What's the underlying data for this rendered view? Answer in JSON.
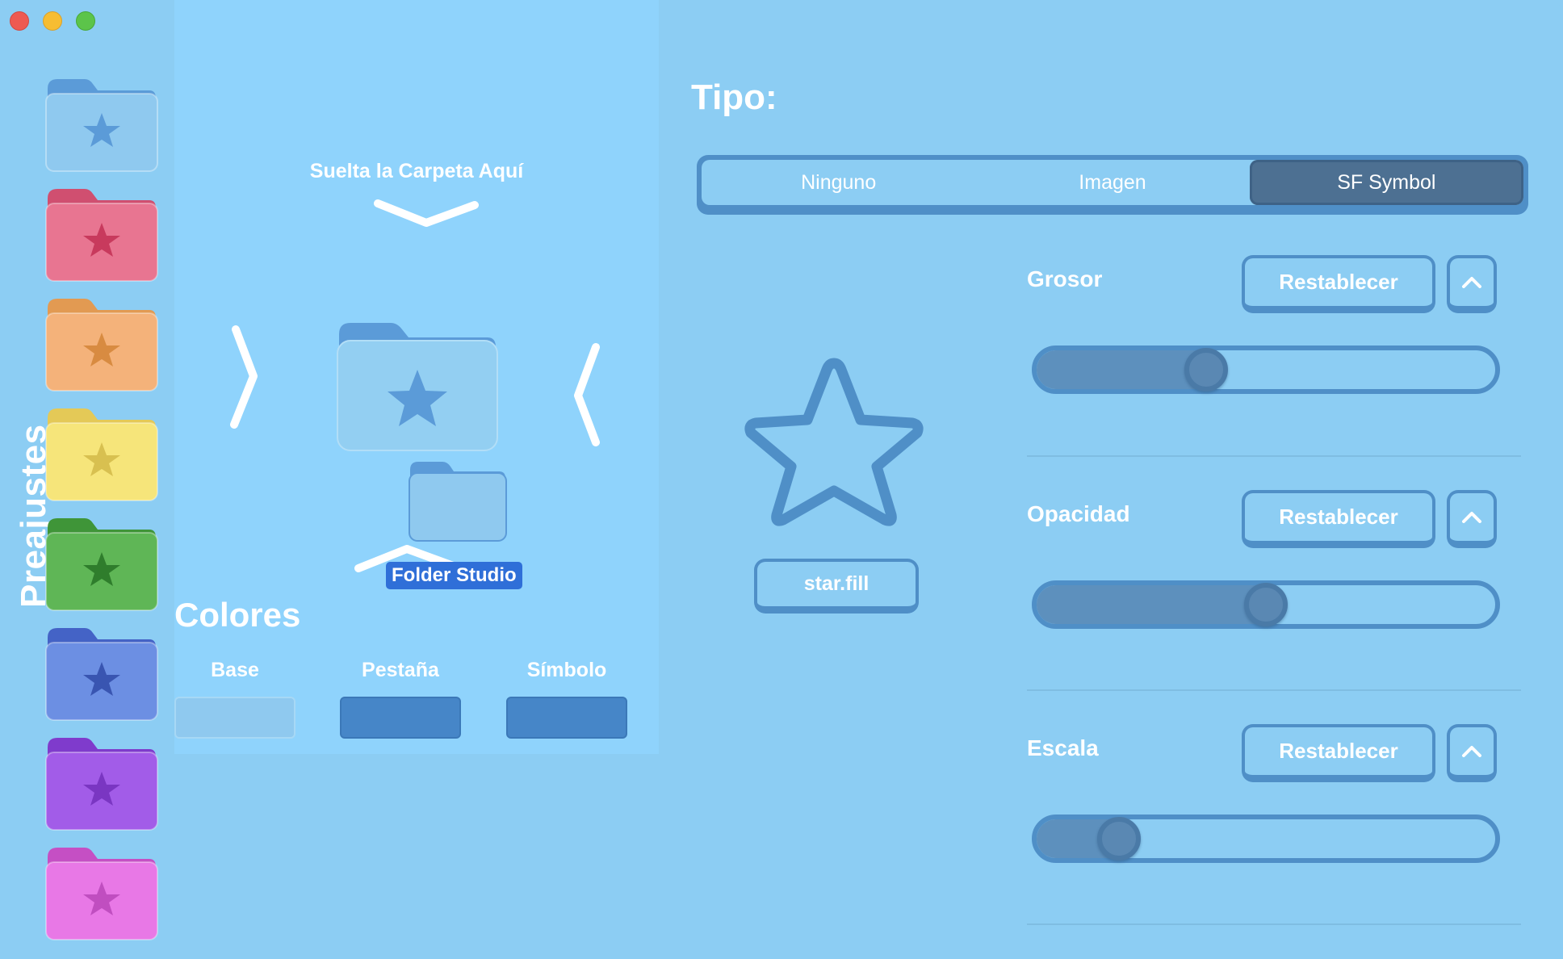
{
  "window": {
    "traffic_lights": [
      "close",
      "minimize",
      "zoom"
    ]
  },
  "sidebar": {
    "title": "Preajustes",
    "presets": [
      {
        "color": "#8fc9ef",
        "tab": "#5b9bd8",
        "symbol": "#5b9bd8"
      },
      {
        "color": "#e87591",
        "tab": "#d04f70",
        "symbol": "#c83a5d"
      },
      {
        "color": "#f4b27a",
        "tab": "#e29a52",
        "symbol": "#d88b41"
      },
      {
        "color": "#f6e57a",
        "tab": "#e4c957",
        "symbol": "#d8c050"
      },
      {
        "color": "#5fb656",
        "tab": "#3f9538",
        "symbol": "#2f7d2c"
      },
      {
        "color": "#6c8fe3",
        "tab": "#4463c6",
        "symbol": "#3955b1"
      },
      {
        "color": "#a25ce8",
        "tab": "#7f3bcc",
        "symbol": "#7a36c2"
      },
      {
        "color": "#e878e6",
        "tab": "#c54fc4",
        "symbol": "#c04ec0"
      }
    ]
  },
  "drop_area": {
    "hint": "Suelta la Carpeta Aquí",
    "drag_label": "Folder Studio"
  },
  "colors": {
    "title": "Colores",
    "items": [
      {
        "label": "Base",
        "value": "#8fc9ef"
      },
      {
        "label": "Pestaña",
        "value": "#4686c8"
      },
      {
        "label": "Símbolo",
        "value": "#4686c8"
      }
    ]
  },
  "tipo": {
    "title": "Tipo:",
    "options": [
      "Ninguno",
      "Imagen",
      "SF Symbol"
    ],
    "selected": "SF Symbol"
  },
  "symbol": {
    "name": "star.fill"
  },
  "params": [
    {
      "label": "Grosor",
      "reset": "Restablecer",
      "value": 0.37
    },
    {
      "label": "Opacidad",
      "reset": "Restablecer",
      "value": 0.5
    },
    {
      "label": "Escala",
      "reset": "Restablecer",
      "value": 0.18
    }
  ]
}
